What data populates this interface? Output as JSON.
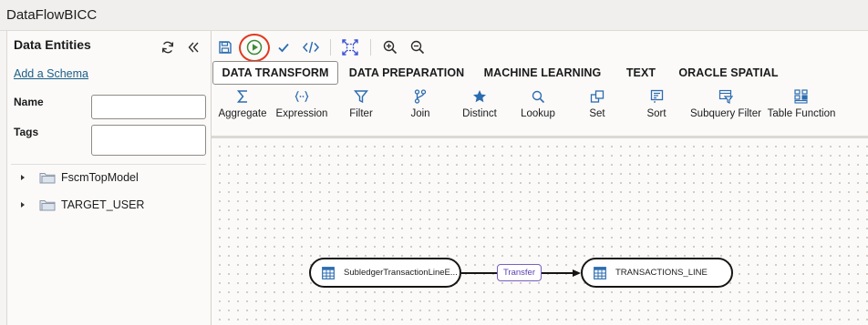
{
  "app": {
    "title": "DataFlowBICC"
  },
  "colors": {
    "accent_blue": "#2c6cb0",
    "run_green": "#3d8b37",
    "run_highlight": "#e03a1e",
    "link_purple": "#5b3fb3"
  },
  "left_panel": {
    "title": "Data Entities",
    "refresh_icon": "refresh-icon",
    "collapse_icon": "double-chevron-left-icon",
    "add_schema_link": "Add a Schema",
    "name_label": "Name",
    "name_value": "",
    "tags_label": "Tags",
    "tags_value": "",
    "tree": [
      {
        "label": "FscmTopModel",
        "icon": "folder-icon",
        "expanded": false
      },
      {
        "label": "TARGET_USER",
        "icon": "folder-icon",
        "expanded": false
      }
    ]
  },
  "toolbar": {
    "buttons": [
      {
        "name": "save",
        "icon": "save-icon"
      },
      {
        "name": "run",
        "icon": "play-icon",
        "highlighted": true
      },
      {
        "name": "validate",
        "icon": "checkmark-icon"
      },
      {
        "name": "code",
        "icon": "code-icon"
      },
      {
        "name": "fit",
        "icon": "fit-to-screen-icon"
      },
      {
        "name": "zoom-in",
        "icon": "zoom-in-icon"
      },
      {
        "name": "zoom-out",
        "icon": "zoom-out-icon"
      }
    ]
  },
  "tabs": [
    {
      "label": "DATA TRANSFORM",
      "active": true
    },
    {
      "label": "DATA PREPARATION",
      "active": false
    },
    {
      "label": "MACHINE LEARNING",
      "active": false
    },
    {
      "label": "TEXT",
      "active": false
    },
    {
      "label": "ORACLE SPATIAL",
      "active": false
    }
  ],
  "tools": [
    {
      "label": "Aggregate",
      "icon": "sigma-icon"
    },
    {
      "label": "Expression",
      "icon": "expression-icon"
    },
    {
      "label": "Filter",
      "icon": "filter-icon"
    },
    {
      "label": "Join",
      "icon": "join-icon"
    },
    {
      "label": "Distinct",
      "icon": "star-icon"
    },
    {
      "label": "Lookup",
      "icon": "search-icon"
    },
    {
      "label": "Set",
      "icon": "set-icon"
    },
    {
      "label": "Sort",
      "icon": "sort-icon"
    },
    {
      "label": "Subquery Filter",
      "icon": "subquery-filter-icon"
    },
    {
      "label": "Table Function",
      "icon": "table-function-icon"
    }
  ],
  "canvas": {
    "source_node": {
      "label": "SubledgerTransactionLineE...",
      "icon": "table-icon"
    },
    "link_label": "Transfer",
    "target_node": {
      "label": "TRANSACTIONS_LINE",
      "icon": "table-icon"
    }
  }
}
